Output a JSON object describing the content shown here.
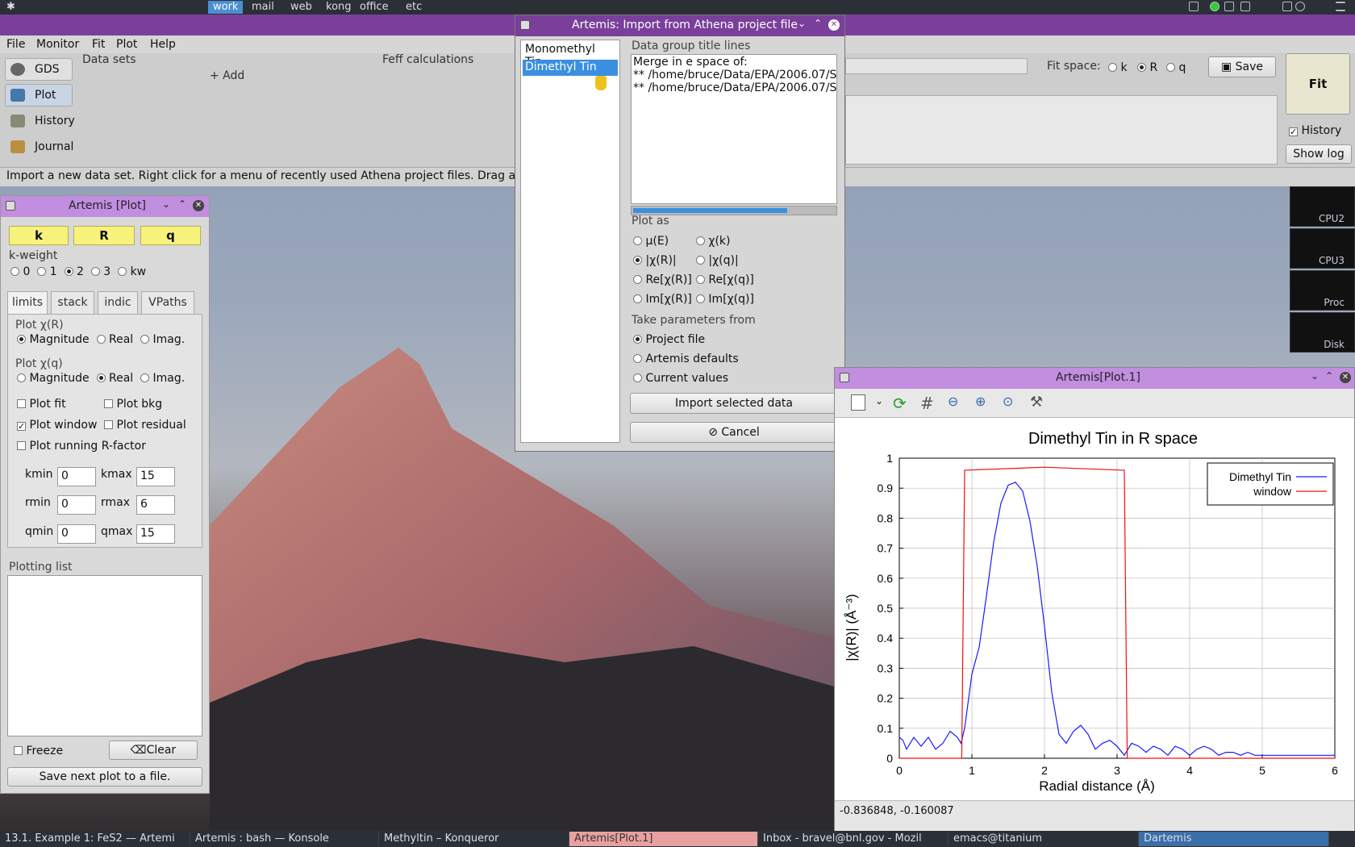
{
  "topbar": {
    "workspaces": [
      "work",
      "mail",
      "web",
      "kong",
      "office",
      "etc"
    ],
    "active": "work"
  },
  "main": {
    "menu": [
      "File",
      "Monitor",
      "Fit",
      "Plot",
      "Help"
    ],
    "side": [
      "GDS",
      "Plot",
      "History",
      "Journal"
    ],
    "datasets_label": "Data sets",
    "add_label": "+ Add",
    "feff_label": "Feff calculations",
    "fitspace_label": "Fit space:",
    "fit_k": "k",
    "fit_r": "R",
    "fit_q": "q",
    "save_label": "Save",
    "fit_label": "Fit",
    "history_label": "History",
    "showlog_label": "Show log",
    "status": "Import a new data set.  Right click for a menu of recently used Athena project files.  Drag and"
  },
  "plotpanel": {
    "title": "Artemis [Plot]",
    "k": "k",
    "r": "R",
    "q": "q",
    "kweight_label": "k-weight",
    "kweights": [
      "0",
      "1",
      "2",
      "3",
      "kw"
    ],
    "tabs": [
      "limits",
      "stack",
      "indic",
      "VPaths"
    ],
    "chir_label": "Plot χ(R)",
    "chiq_label": "Plot χ(q)",
    "mag": "Magnitude",
    "real": "Real",
    "imag": "Imag.",
    "plotfit": "Plot fit",
    "plotbkg": "Plot bkg",
    "plotwindow": "Plot window",
    "plotresidual": "Plot residual",
    "running": "Plot running R-factor",
    "kmin_label": "kmin",
    "kmin": "0",
    "kmax_label": "kmax",
    "kmax": "15",
    "rmin_label": "rmin",
    "rmin": "0",
    "rmax_label": "rmax",
    "rmax": "6",
    "qmin_label": "qmin",
    "qmin": "0",
    "qmax_label": "qmax",
    "qmax": "15",
    "plotting_list": "Plotting list",
    "freeze": "Freeze",
    "clear": "Clear",
    "save_next": "Save next plot to a file."
  },
  "import": {
    "title": "Artemis: Import from Athena project file",
    "groups": [
      "Monomethyl Tin",
      "Dimethyl Tin"
    ],
    "title_lines_label": "Data group title lines",
    "title_lines": [
      "Merge in e space of:",
      "** /home/bruce/Data/EPA/2006.07/S",
      "** /home/bruce/Data/EPA/2006.07/S"
    ],
    "plotas_label": "Plot as",
    "plotas": [
      "μ(E)",
      "χ(k)",
      "|χ(R)|",
      "|χ(q)|",
      "Re[χ(R)]",
      "Re[χ(q)]",
      "Im[χ(R)]",
      "Im[χ(q)]"
    ],
    "params_label": "Take parameters from",
    "params": [
      "Project file",
      "Artemis defaults",
      "Current values"
    ],
    "import_btn": "Import selected data",
    "cancel_btn": "Cancel"
  },
  "plotwin": {
    "title": "Artemis[Plot.1]",
    "coords": "-0.836848, -0.160087"
  },
  "chart_data": {
    "type": "line",
    "title": "Dimethyl Tin in R space",
    "xlabel": "Radial distance   (Å)",
    "ylabel": "|χ(R)|   (Å⁻³)",
    "xlim": [
      0,
      6
    ],
    "ylim": [
      0,
      1
    ],
    "xticks": [
      "0",
      "1",
      "2",
      "3",
      "4",
      "5",
      "6"
    ],
    "yticks": [
      "0",
      "0.1",
      "0.2",
      "0.3",
      "0.4",
      "0.5",
      "0.6",
      "0.7",
      "0.8",
      "0.9",
      "1"
    ],
    "legend": "top-right",
    "grid": true,
    "series": [
      {
        "name": "Dimethyl Tin",
        "color": "#1a1aff",
        "x": [
          0,
          0.05,
          0.1,
          0.2,
          0.3,
          0.4,
          0.5,
          0.6,
          0.7,
          0.8,
          0.85,
          0.9,
          1.0,
          1.1,
          1.2,
          1.3,
          1.4,
          1.5,
          1.6,
          1.7,
          1.8,
          1.9,
          2.0,
          2.1,
          2.2,
          2.3,
          2.4,
          2.5,
          2.6,
          2.7,
          2.8,
          2.9,
          3.0,
          3.1,
          3.2,
          3.3,
          3.4,
          3.5,
          3.6,
          3.7,
          3.8,
          3.9,
          4.0,
          4.1,
          4.2,
          4.3,
          4.4,
          4.5,
          4.6,
          4.7,
          4.8,
          4.9,
          5.0,
          5.2,
          5.4,
          5.6,
          5.8,
          6.0
        ],
        "y": [
          0.07,
          0.06,
          0.03,
          0.07,
          0.04,
          0.07,
          0.03,
          0.05,
          0.09,
          0.07,
          0.05,
          0.1,
          0.28,
          0.37,
          0.54,
          0.72,
          0.85,
          0.91,
          0.92,
          0.89,
          0.79,
          0.64,
          0.44,
          0.22,
          0.08,
          0.05,
          0.09,
          0.11,
          0.08,
          0.03,
          0.05,
          0.06,
          0.04,
          0.01,
          0.05,
          0.04,
          0.02,
          0.04,
          0.03,
          0.01,
          0.04,
          0.03,
          0.01,
          0.03,
          0.04,
          0.03,
          0.01,
          0.02,
          0.02,
          0.01,
          0.02,
          0.01,
          0.01,
          0.01,
          0.01,
          0.01,
          0.01,
          0.01
        ]
      },
      {
        "name": "window",
        "color": "#ee1111",
        "x": [
          0,
          0.86,
          0.9,
          2.0,
          3.1,
          3.14,
          6.0
        ],
        "y": [
          0,
          0,
          0.96,
          0.97,
          0.96,
          0,
          0
        ]
      }
    ]
  },
  "meters": [
    "CPU2",
    "CPU3",
    "Proc",
    "Disk"
  ],
  "taskbar": [
    "13.1. Example 1: FeS2 — Artemi",
    "Artemis : bash — Konsole",
    "Methyltin – Konqueror",
    "Artemis[Plot.1]",
    "Inbox - bravel@bnl.gov - Mozil",
    "emacs@titanium",
    "Dartemis"
  ]
}
